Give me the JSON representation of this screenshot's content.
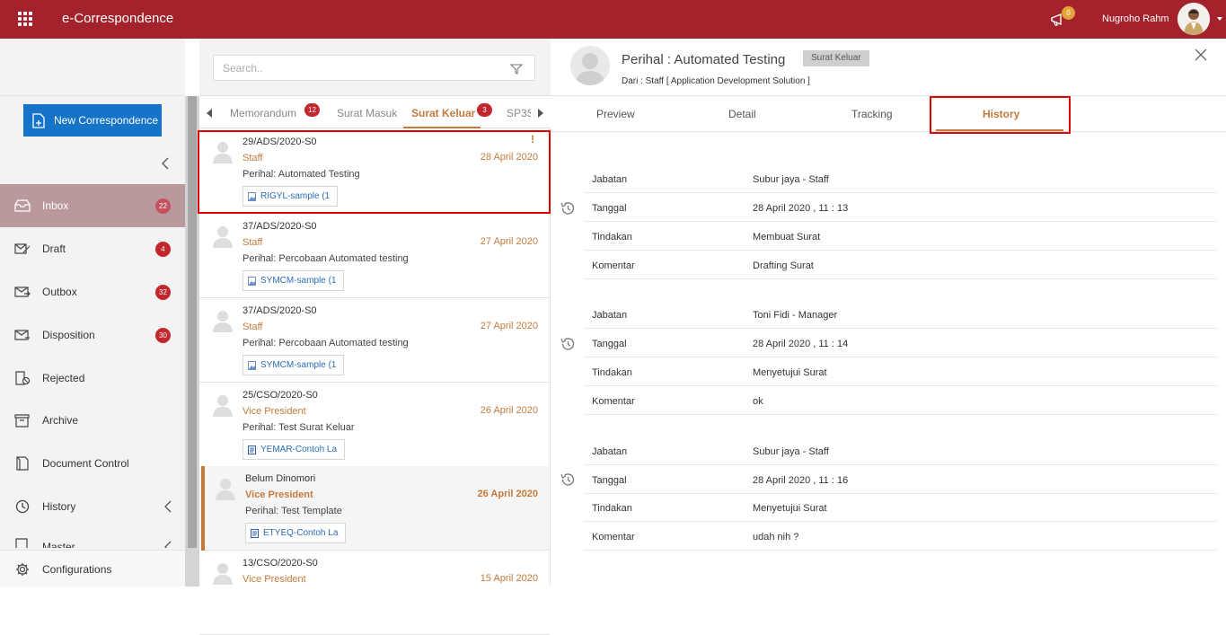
{
  "app": {
    "title": "e-Correspondence",
    "notif_count": "0",
    "username": "Nugroho Rahm"
  },
  "sidebar": {
    "new_button": "New Correspondence",
    "items": [
      {
        "label": "Inbox",
        "badge": "22",
        "icon": "inbox-icon"
      },
      {
        "label": "Draft",
        "badge": "4",
        "icon": "draft-icon"
      },
      {
        "label": "Outbox",
        "badge": "32",
        "icon": "outbox-icon"
      },
      {
        "label": "Disposition",
        "badge": "30",
        "icon": "disposition-icon"
      },
      {
        "label": "Rejected",
        "icon": "rejected-icon"
      },
      {
        "label": "Archive",
        "icon": "archive-icon"
      },
      {
        "label": "Document Control",
        "icon": "document-control-icon"
      },
      {
        "label": "History",
        "icon": "history-icon"
      },
      {
        "label": "Master",
        "icon": "master-icon"
      }
    ],
    "configurations": "Configurations"
  },
  "list": {
    "search_placeholder": "Search..",
    "tabs": [
      {
        "label": "Memorandum",
        "badge": "12"
      },
      {
        "label": "Surat Masuk"
      },
      {
        "label": "Surat Keluar",
        "badge": "3"
      },
      {
        "label": "SP3S"
      }
    ],
    "items": [
      {
        "no": "29/ADS/2020-S0",
        "from": "Staff",
        "date": "28 April 2020",
        "perihal": "Perihal: Automated Testing",
        "attachment": "RIGYL-sample (1",
        "flag": "!"
      },
      {
        "no": "37/ADS/2020-S0",
        "from": "Staff",
        "date": "27 April 2020",
        "perihal": "Perihal: Percobaan Automated testing",
        "attachment": "SYMCM-sample (1"
      },
      {
        "no": "37/ADS/2020-S0",
        "from": "Staff",
        "date": "27 April 2020",
        "perihal": "Perihal: Percobaan Automated testing",
        "attachment": "SYMCM-sample (1"
      },
      {
        "no": "25/CSO/2020-S0",
        "from": "Vice President",
        "date": "26 April 2020",
        "perihal": "Perihal: Test Surat Keluar",
        "attachment": "YEMAR-Contoh La"
      },
      {
        "no": "Belum Dinomori",
        "from": "Vice President",
        "date": "26 April 2020",
        "perihal": "Perihal: Test Template",
        "attachment": "ETYEQ-Contoh La"
      },
      {
        "no": "13/CSO/2020-S0",
        "from": "Vice President",
        "date": "15 April 2020",
        "perihal": "",
        "attachment": ""
      }
    ]
  },
  "detail": {
    "title": "Perihal : Automated Testing",
    "badge": "Surat Keluar",
    "from": "Dari : Staff [ Application Development Solution ]",
    "tabs": [
      "Preview",
      "Detail",
      "Tracking",
      "History"
    ],
    "history": [
      {
        "rows": [
          {
            "key": "Jabatan",
            "value": "Subur jaya - Staff"
          },
          {
            "key": "Tanggal",
            "value": "28 April 2020 , 11 : 13"
          },
          {
            "key": "Tindakan",
            "value": "Membuat Surat"
          },
          {
            "key": "Komentar",
            "value": "Drafting Surat"
          }
        ]
      },
      {
        "rows": [
          {
            "key": "Jabatan",
            "value": "Toni Fidi - Manager"
          },
          {
            "key": "Tanggal",
            "value": "28 April 2020 , 11 : 14"
          },
          {
            "key": "Tindakan",
            "value": "Menyetujui Surat"
          },
          {
            "key": "Komentar",
            "value": "ok"
          }
        ]
      },
      {
        "rows": [
          {
            "key": "Jabatan",
            "value": "Subur jaya - Staff"
          },
          {
            "key": "Tanggal",
            "value": "28 April 2020 , 11 : 16"
          },
          {
            "key": "Tindakan",
            "value": "Menyetujui Surat"
          },
          {
            "key": "Komentar",
            "value": "udah nih ?"
          }
        ]
      }
    ]
  },
  "colors": {
    "brand": "#a3222c",
    "accent": "#c47a3b",
    "primary_button": "#1573c8",
    "badge": "#c1272d",
    "highlight": "#e00000"
  }
}
